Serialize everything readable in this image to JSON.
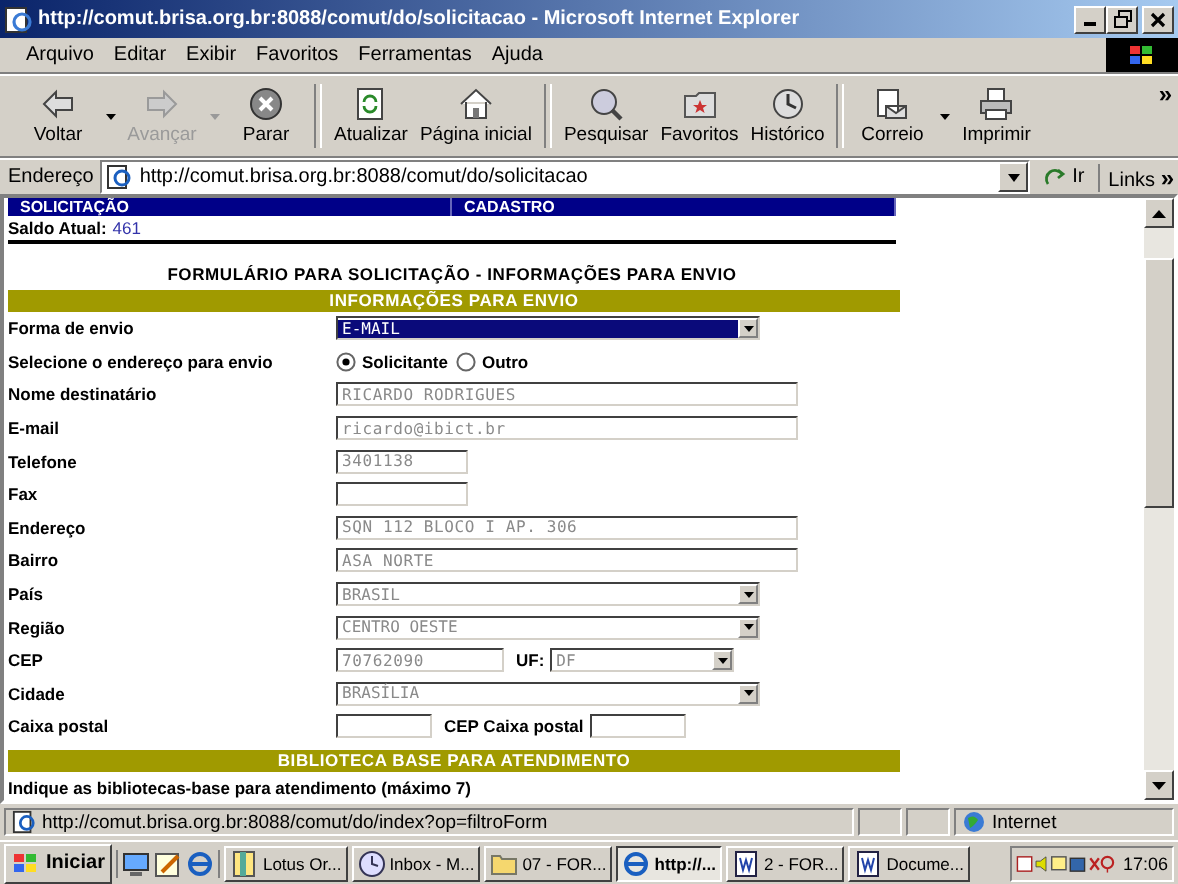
{
  "window": {
    "title": "http://comut.brisa.org.br:8088/comut/do/solicitacao - Microsoft Internet Explorer"
  },
  "menu": [
    "Arquivo",
    "Editar",
    "Exibir",
    "Favoritos",
    "Ferramentas",
    "Ajuda"
  ],
  "toolbar": {
    "buttons": [
      {
        "label": "Voltar",
        "kind": "back",
        "disabled": false,
        "dropdown": true
      },
      {
        "label": "Avançar",
        "kind": "forward",
        "disabled": true,
        "dropdown": true
      },
      {
        "label": "Parar",
        "kind": "stop",
        "disabled": false,
        "dropdown": false
      },
      {
        "label": "Atualizar",
        "kind": "refresh",
        "disabled": false,
        "dropdown": false
      },
      {
        "label": "Página inicial",
        "kind": "home",
        "disabled": false,
        "dropdown": false
      },
      {
        "label": "Pesquisar",
        "kind": "search",
        "disabled": false,
        "dropdown": false
      },
      {
        "label": "Favoritos",
        "kind": "favorites",
        "disabled": false,
        "dropdown": false
      },
      {
        "label": "Histórico",
        "kind": "history",
        "disabled": false,
        "dropdown": false
      },
      {
        "label": "Correio",
        "kind": "mail",
        "disabled": false,
        "dropdown": true
      },
      {
        "label": "Imprimir",
        "kind": "print",
        "disabled": false,
        "dropdown": false
      }
    ],
    "more": "»"
  },
  "address_bar": {
    "label": "Endereço",
    "url": "http://comut.brisa.org.br:8088/comut/do/solicitacao",
    "go": "Ir",
    "links": "Links",
    "links_more": "»"
  },
  "page": {
    "nav_tabs": [
      "SOLICITAÇÃO",
      "CADASTRO"
    ],
    "balance": {
      "label": "Saldo Atual:",
      "value": "461"
    },
    "form_title": "FORMULÁRIO PARA SOLICITAÇÃO - INFORMAÇÕES PARA ENVIO",
    "sections": [
      {
        "header": "INFORMAÇÕES PARA ENVIO",
        "rows": [
          {
            "label": "Forma de envio",
            "kind": "select",
            "value": "E-MAIL",
            "disabled": false
          },
          {
            "label": "Selecione o endereço para envio",
            "kind": "radio",
            "options": [
              {
                "label": "Solicitante",
                "selected": true
              },
              {
                "label": "Outro",
                "selected": false
              }
            ]
          },
          {
            "label": "Nome destinatário",
            "kind": "text",
            "value": "RICARDO RODRIGUES",
            "disabled": true
          },
          {
            "label": "E-mail",
            "kind": "text",
            "value": "ricardo@ibict.br",
            "disabled": true
          },
          {
            "label": "Telefone",
            "kind": "short-text",
            "value": "3401138",
            "disabled": true
          },
          {
            "label": "Fax",
            "kind": "short-text"
          },
          {
            "label": "Endereço",
            "kind": "text",
            "value": "SQN 112 BLOCO I AP. 306",
            "disabled": true
          },
          {
            "label": "Bairro",
            "kind": "text",
            "value": "ASA NORTE",
            "disabled": true
          },
          {
            "label": "País",
            "kind": "select",
            "value": "BRASIL",
            "disabled": true
          },
          {
            "label": "Região",
            "kind": "select",
            "value": "CENTRO OESTE",
            "disabled": true
          },
          {
            "label": "CEP",
            "kind": "cep-uf",
            "value": "70762090",
            "disabled": true,
            "second_label": "UF:",
            "second_value": "DF"
          },
          {
            "label": "Cidade",
            "kind": "select",
            "value": "BRASÍLIA",
            "disabled": true
          },
          {
            "label": "Caixa postal",
            "kind": "postal-box",
            "second_label": "CEP Caixa postal"
          }
        ]
      },
      {
        "header": "BIBLIOTECA BASE PARA ATENDIMENTO",
        "rows": [
          {
            "label": "Indique as bibliotecas-base para atendimento (máximo 7)",
            "kind": "note"
          }
        ]
      }
    ]
  },
  "status_bar": {
    "text": "http://comut.brisa.org.br:8088/comut/do/index?op=filtroForm",
    "zone": "Internet"
  },
  "taskbar": {
    "start": "Iniciar",
    "tasks": [
      {
        "label": "Lotus Or...",
        "kind": "notes",
        "selected": false
      },
      {
        "label": "Inbox - M...",
        "kind": "mail",
        "selected": false
      },
      {
        "label": "07 - FOR...",
        "kind": "folder",
        "selected": false
      },
      {
        "label": "http://...",
        "kind": "browser",
        "selected": true
      },
      {
        "label": "2 - FOR...",
        "kind": "word",
        "selected": false
      },
      {
        "label": "Docume...",
        "kind": "word",
        "selected": false
      }
    ],
    "clock": "17:06"
  }
}
